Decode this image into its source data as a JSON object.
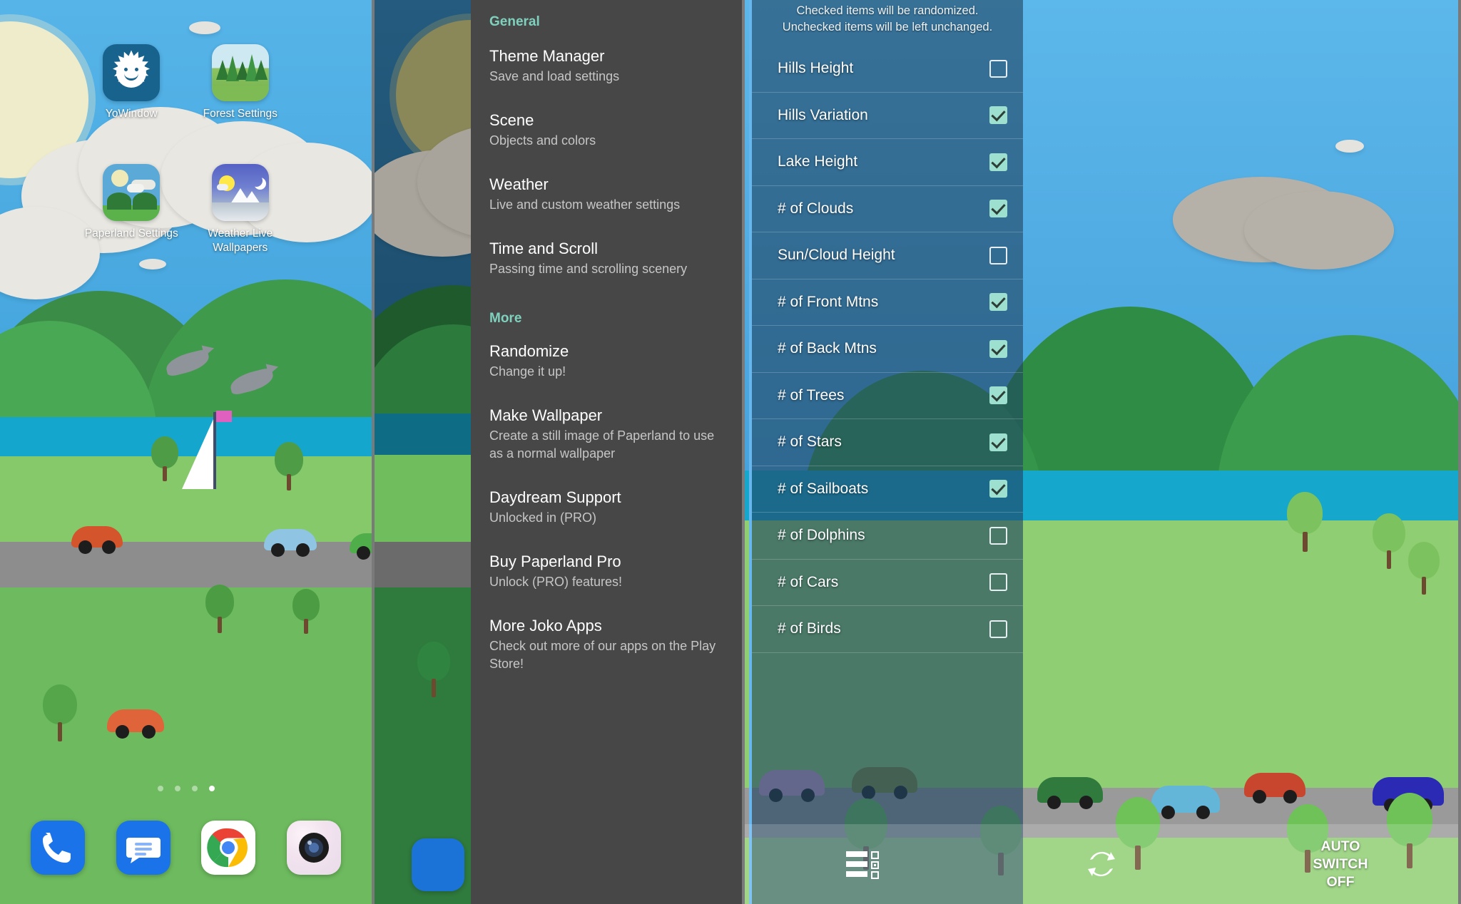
{
  "panel1": {
    "name": "home-screen",
    "apps": [
      {
        "label": "YoWindow",
        "icon": "yowindow-icon"
      },
      {
        "label": "Forest Settings",
        "icon": "forest-settings-icon"
      },
      {
        "label": "Paperland Settings",
        "icon": "paperland-settings-icon"
      },
      {
        "label": "Weather Live Wallpapers",
        "icon": "weather-live-wallpapers-icon"
      }
    ],
    "page_dots": {
      "count": 4,
      "active_index": 3
    },
    "dock": [
      {
        "name": "phone-icon"
      },
      {
        "name": "messages-icon"
      },
      {
        "name": "chrome-icon"
      },
      {
        "name": "camera-icon"
      }
    ]
  },
  "panel2": {
    "name": "paperland-settings-menu",
    "sections": [
      {
        "heading": "General",
        "items": [
          {
            "title": "Theme Manager",
            "sub": "Save and load settings"
          },
          {
            "title": "Scene",
            "sub": "Objects and colors"
          },
          {
            "title": "Weather",
            "sub": "Live and custom weather settings"
          },
          {
            "title": "Time and Scroll",
            "sub": "Passing time and scrolling scenery"
          }
        ]
      },
      {
        "heading": "More",
        "items": [
          {
            "title": "Randomize",
            "sub": "Change it up!"
          },
          {
            "title": "Make Wallpaper",
            "sub": "Create a still image of Paperland to use as a normal wallpaper"
          },
          {
            "title": "Daydream Support",
            "sub": "Unlocked in (PRO)"
          },
          {
            "title": "Buy Paperland Pro",
            "sub": "Unlock (PRO) features!"
          },
          {
            "title": "More Joko Apps",
            "sub": "Check out more of our apps on the Play Store!"
          }
        ]
      }
    ]
  },
  "panel3": {
    "name": "randomize-panel",
    "note_line1": "Checked items will be randomized.",
    "note_line2": "Unchecked items will be left unchanged.",
    "items": [
      {
        "label": "Hills Height",
        "checked": false
      },
      {
        "label": "Hills Variation",
        "checked": true
      },
      {
        "label": "Lake Height",
        "checked": true
      },
      {
        "label": "# of Clouds",
        "checked": true
      },
      {
        "label": "Sun/Cloud Height",
        "checked": false
      },
      {
        "label": "# of Front Mtns",
        "checked": true
      },
      {
        "label": "# of Back Mtns",
        "checked": true
      },
      {
        "label": "# of Trees",
        "checked": true
      },
      {
        "label": "# of Stars",
        "checked": true
      },
      {
        "label": "# of Sailboats",
        "checked": true
      },
      {
        "label": "# of Dolphins",
        "checked": false
      },
      {
        "label": "# of Cars",
        "checked": false
      },
      {
        "label": "# of Birds",
        "checked": false
      }
    ],
    "bottom_bar": {
      "list_icon": "list-checkbox-icon",
      "refresh_icon": "refresh-randomize-icon",
      "auto_switch_label": "AUTO\nSWITCH\nOFF"
    }
  },
  "colors": {
    "accent_teal": "#7fd1bd",
    "checkbox_on": "#9ee0cf",
    "menu_bg": "#474747",
    "panel_border": "#67b6ee",
    "sky_light": "#56b4e8",
    "sky_dark": "#245b7e"
  }
}
